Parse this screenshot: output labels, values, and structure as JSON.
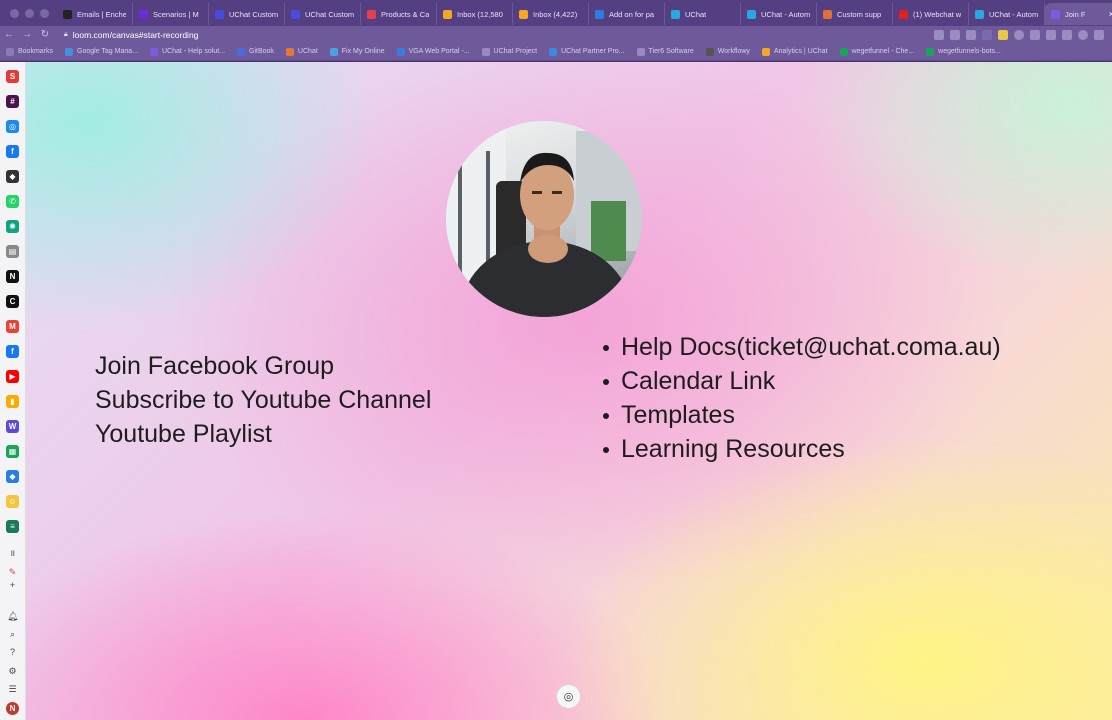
{
  "browser": {
    "tabs": [
      {
        "label": "Emails | Enche",
        "color": "#222222"
      },
      {
        "label": "Scenarios | M",
        "color": "#6d2bd9"
      },
      {
        "label": "UChat Custom",
        "color": "#4a4adf"
      },
      {
        "label": "UChat Custom",
        "color": "#4a4adf"
      },
      {
        "label": "Products & Ca",
        "color": "#e0404f"
      },
      {
        "label": "Inbox (12,580",
        "color": "#f5a623"
      },
      {
        "label": "Inbox (4,422)",
        "color": "#f5a623"
      },
      {
        "label": "Add on for pa",
        "color": "#2a7de1"
      },
      {
        "label": "UChat",
        "color": "#2aa7e1"
      },
      {
        "label": "UChat - Autom",
        "color": "#2aa7e1"
      },
      {
        "label": "Custom supp",
        "color": "#e0703a"
      },
      {
        "label": "(1) Webchat w",
        "color": "#e02020"
      },
      {
        "label": "UChat - Autom",
        "color": "#2aa7e1"
      },
      {
        "label": "Join F",
        "color": "#7d5ae0",
        "active": true
      }
    ],
    "new_tab": "+",
    "url": "loom.com/canvas#start-recording",
    "bookmarks": [
      {
        "label": "Bookmarks",
        "color": "#8a7ab8"
      },
      {
        "label": "Google Tag Mana...",
        "color": "#4a8de1"
      },
      {
        "label": "UChat - Help solut...",
        "color": "#7d5ae0"
      },
      {
        "label": "GitBook",
        "color": "#4a6ae1"
      },
      {
        "label": "UChat",
        "color": "#e07a30"
      },
      {
        "label": "Fix My Online",
        "color": "#4aa0e1"
      },
      {
        "label": "VGA Web Portal -...",
        "color": "#3a7ae1"
      },
      {
        "label": "UChat Project",
        "color": "#9a8ac0"
      },
      {
        "label": "UChat Partner Pro...",
        "color": "#3a8ae1"
      },
      {
        "label": "Tier6 Software",
        "color": "#9a8ac0"
      },
      {
        "label": "Workflowy",
        "color": "#555555"
      },
      {
        "label": "Analytics | UChat",
        "color": "#f5a623"
      },
      {
        "label": "wegetfunnel - Che...",
        "color": "#1aa35a"
      },
      {
        "label": "wegetfunnels-bots...",
        "color": "#1aa35a"
      }
    ]
  },
  "dock": {
    "items": [
      {
        "name": "shortcut-app-icon",
        "color": "#e03a3a",
        "glyph": "S"
      },
      {
        "name": "slack-icon",
        "color": "#4a154b",
        "glyph": "#"
      },
      {
        "name": "messenger-icon",
        "color": "#1a8af0",
        "glyph": "◎"
      },
      {
        "name": "facebook-icon",
        "color": "#1877f2",
        "glyph": "f"
      },
      {
        "name": "github-icon",
        "color": "#333333",
        "glyph": "◆"
      },
      {
        "name": "whatsapp-icon",
        "color": "#25d366",
        "glyph": "✆"
      },
      {
        "name": "chatgpt-icon",
        "color": "#10a37f",
        "glyph": "✺"
      },
      {
        "name": "notes-icon",
        "color": "#888888",
        "glyph": "▤"
      },
      {
        "name": "notion-icon",
        "color": "#111111",
        "glyph": "N"
      },
      {
        "name": "c-app-icon",
        "color": "#111111",
        "glyph": "C"
      },
      {
        "name": "gmail-icon",
        "color": "#ea4335",
        "glyph": "M"
      },
      {
        "name": "facebook-icon",
        "color": "#1877f2",
        "glyph": "f"
      },
      {
        "name": "youtube-icon",
        "color": "#ff0000",
        "glyph": "▶"
      },
      {
        "name": "analytics-icon",
        "color": "#f9ab00",
        "glyph": "▮"
      },
      {
        "name": "w-app-icon",
        "color": "#5b4bd6",
        "glyph": "W"
      },
      {
        "name": "sheets-icon",
        "color": "#1aa35a",
        "glyph": "▦"
      },
      {
        "name": "diamond-app-icon",
        "color": "#2a7de1",
        "glyph": "◆"
      },
      {
        "name": "emoji-icon",
        "color": "#f5c542",
        "glyph": "☺"
      },
      {
        "name": "list-app-icon",
        "color": "#1a7a5a",
        "glyph": "≡"
      }
    ]
  },
  "content": {
    "left_links": [
      "Join Facebook Group",
      "Subscribe to Youtube Channel",
      "Youtube Playlist"
    ],
    "right_list": [
      "Help Docs(ticket@uchat.coma.au)",
      "Calendar Link",
      "Templates",
      "Learning Resources"
    ]
  },
  "colors": {
    "browser_tab_bar": "#553f83",
    "browser_toolbar": "#6e5a9b",
    "text": "#1d1d1f"
  }
}
